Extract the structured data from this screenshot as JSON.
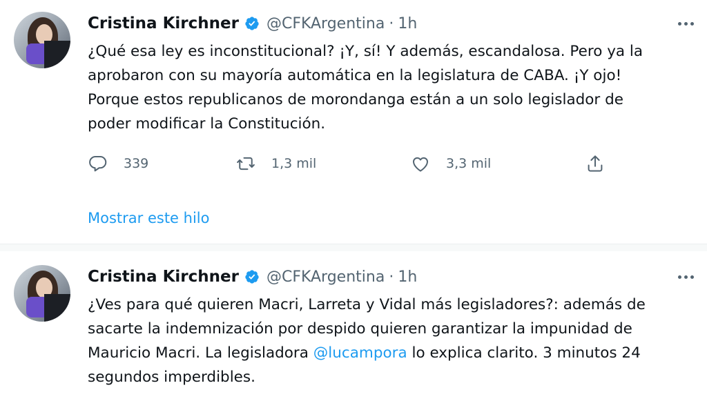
{
  "tweets": [
    {
      "author": {
        "name": "Cristina Kirchner",
        "handle": "@CFKArgentina",
        "separator": "·",
        "time": "1h"
      },
      "text": "¿Qué esa ley es inconstitucional? ¡Y, sí! Y además, escandalosa. Pero ya la\naprobaron con su mayoría automática en la legislatura de CABA. ¡Y ojo!\nPorque estos republicanos de morondanga están a un solo legislador de\npoder modificar la Constitución.",
      "actions": {
        "replies": "339",
        "retweets": "1,3 mil",
        "likes": "3,3 mil"
      },
      "show_thread": "Mostrar este hilo"
    },
    {
      "author": {
        "name": "Cristina Kirchner",
        "handle": "@CFKArgentina",
        "separator": "·",
        "time": "1h"
      },
      "text_before_mention": "¿Ves para qué quieren Macri, Larreta y Vidal más legisladores?: además de\nsacarte la indemnización por despido quieren garantizar la impunidad de\nMauricio Macri. La legisladora ",
      "mention": "@lucampora",
      "text_after_mention": " lo explica clarito. 3 minutos 24\nsegundos imperdibles."
    }
  ],
  "colors": {
    "accent": "#1d9bf0",
    "muted": "#536471",
    "text": "#0f1419",
    "divider": "#f7f9f9"
  },
  "icons": [
    "verified-icon",
    "more-icon",
    "reply-icon",
    "retweet-icon",
    "like-icon",
    "share-icon"
  ]
}
